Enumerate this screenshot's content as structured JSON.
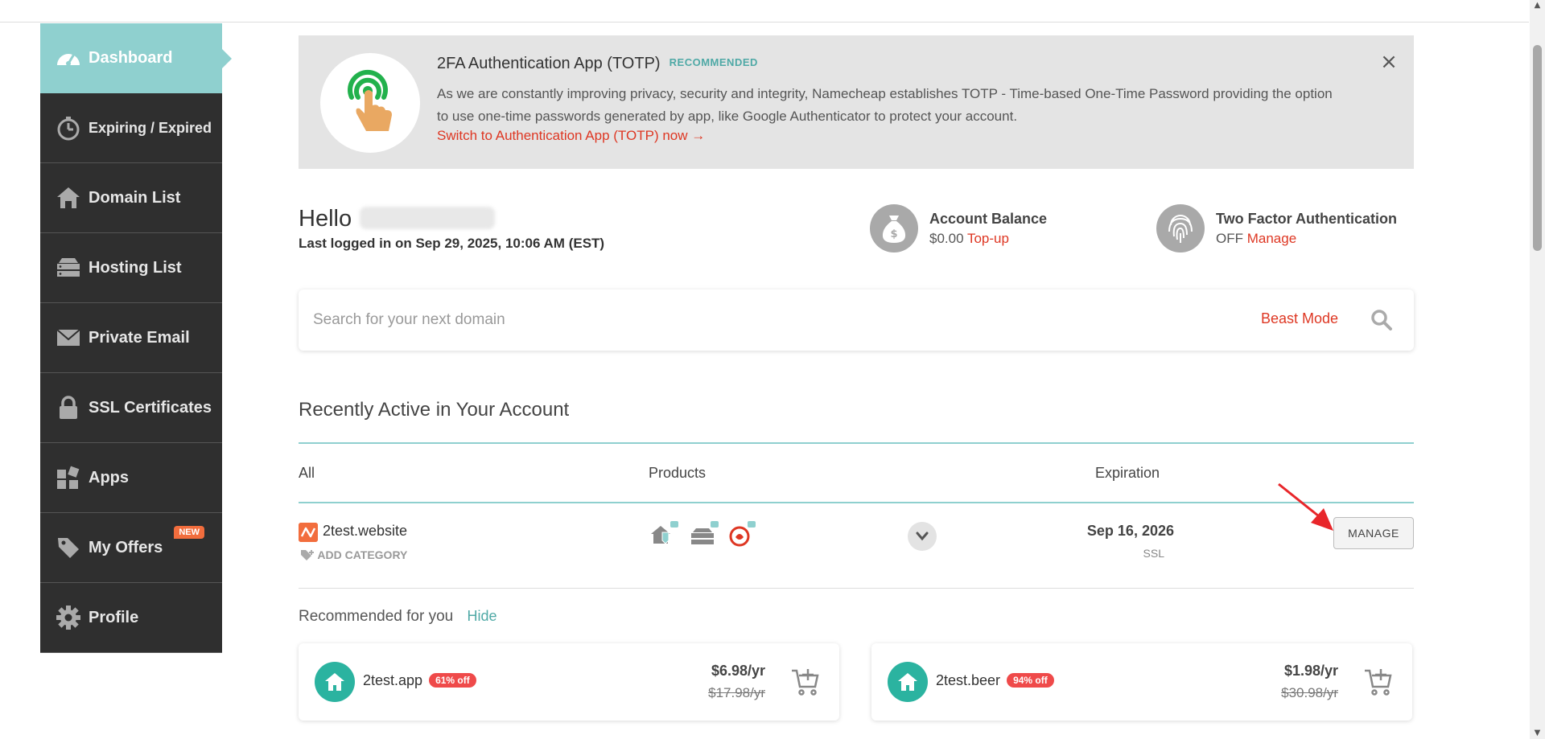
{
  "sidebar": {
    "items": [
      {
        "label": "Dashboard",
        "icon": "speedometer-icon",
        "active": true
      },
      {
        "label": "Expiring / Expired",
        "icon": "stopwatch-icon"
      },
      {
        "label": "Domain List",
        "icon": "house-icon"
      },
      {
        "label": "Hosting List",
        "icon": "server-icon"
      },
      {
        "label": "Private Email",
        "icon": "envelope-icon"
      },
      {
        "label": "SSL Certificates",
        "icon": "lock-icon"
      },
      {
        "label": "Apps",
        "icon": "apps-grid-icon"
      },
      {
        "label": "My Offers",
        "icon": "tag-icon",
        "badge": "NEW"
      },
      {
        "label": "Profile",
        "icon": "gear-icon"
      }
    ]
  },
  "banner": {
    "title": "2FA Authentication App (TOTP)",
    "tag": "RECOMMENDED",
    "body": "As we are constantly improving privacy, security and integrity, Namecheap establishes TOTP - Time-based One-Time Password providing the option to use one-time passwords generated by app, like Google Authenticator to protect your account.",
    "link": "Switch to Authentication App (TOTP) now →",
    "close": "×"
  },
  "greeting": {
    "hello": "Hello",
    "last_login": "Last logged in on Sep 29, 2025, 10:06 AM (EST)"
  },
  "account_balance": {
    "title": "Account Balance",
    "value": "$0.00",
    "link": "Top-up"
  },
  "two_factor": {
    "title": "Two Factor Authentication",
    "value": "OFF",
    "link": "Manage"
  },
  "search": {
    "placeholder": "Search for your next domain",
    "beast_mode": "Beast Mode"
  },
  "recent": {
    "title": "Recently Active in Your Account",
    "columns": {
      "all": "All",
      "products": "Products",
      "expiration": "Expiration"
    },
    "rows": [
      {
        "domain": "2test.website",
        "add_category": "ADD CATEGORY",
        "expiration": "Sep 16, 2026",
        "expiration_sub": "SSL",
        "action": "MANAGE"
      }
    ]
  },
  "recommended": {
    "title": "Recommended for you",
    "hide": "Hide",
    "cards": [
      {
        "name": "2test.app",
        "discount": "61% off",
        "price": "$6.98/yr",
        "old_price": "$17.98/yr"
      },
      {
        "name": "2test.beer",
        "discount": "94% off",
        "price": "$1.98/yr",
        "old_price": "$30.98/yr"
      }
    ]
  },
  "colors": {
    "accent": "#8fd0cf",
    "link_red": "#de3723",
    "sidebar_bg": "#2f2f2f",
    "badge_orange": "#f26d3d"
  }
}
